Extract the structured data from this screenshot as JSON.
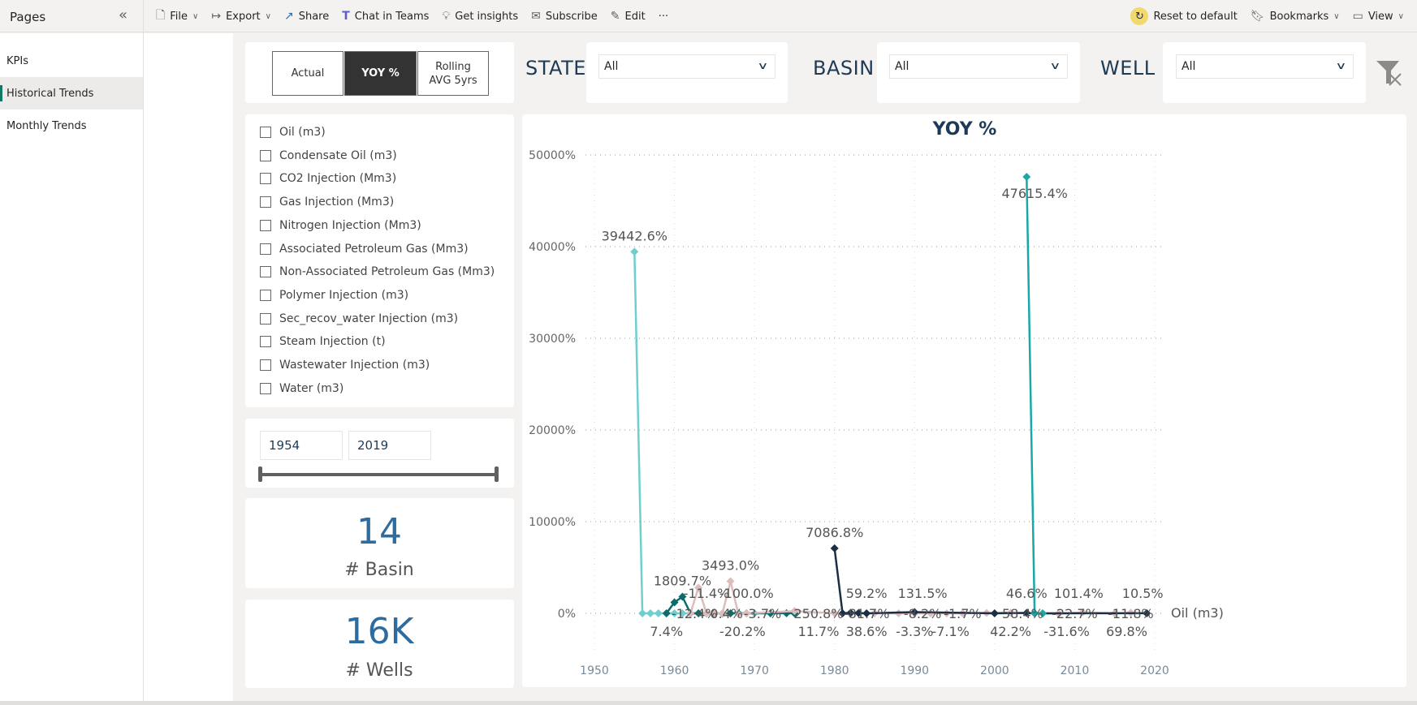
{
  "pages_panel": {
    "title": "Pages",
    "items": [
      {
        "label": "KPIs",
        "active": false
      },
      {
        "label": "Historical Trends",
        "active": true
      },
      {
        "label": "Monthly Trends",
        "active": false
      }
    ]
  },
  "toolbar": {
    "file": "File",
    "export": "Export",
    "share": "Share",
    "chat_in_teams": "Chat in Teams",
    "get_insights": "Get insights",
    "subscribe": "Subscribe",
    "edit": "Edit",
    "more": "···",
    "reset": "Reset to default",
    "bookmarks": "Bookmarks",
    "view": "View"
  },
  "mode_toggle": {
    "actual": "Actual",
    "yoy": "YOY %",
    "rolling_1": "Rolling",
    "rolling_2": "AVG 5yrs",
    "selected": "YOY %"
  },
  "filters": {
    "state": {
      "label": "STATE",
      "value": "All"
    },
    "basin": {
      "label": "BASIN",
      "value": "All"
    },
    "well": {
      "label": "WELL",
      "value": "All"
    }
  },
  "measures": [
    {
      "label": "Oil (m3)",
      "checked": false
    },
    {
      "label": "Condensate Oil (m3)",
      "checked": false
    },
    {
      "label": "CO2 Injection (Mm3)",
      "checked": false
    },
    {
      "label": "Gas Injection (Mm3)",
      "checked": false
    },
    {
      "label": "Nitrogen Injection (Mm3)",
      "checked": false
    },
    {
      "label": "Associated Petroleum Gas (Mm3)",
      "checked": false
    },
    {
      "label": "Non-Associated Petroleum Gas (Mm3)",
      "checked": false
    },
    {
      "label": "Polymer Injection (m3)",
      "checked": false
    },
    {
      "label": "Sec_recov_water Injection (m3)",
      "checked": false
    },
    {
      "label": "Steam Injection (t)",
      "checked": false
    },
    {
      "label": "Wastewater Injection (m3)",
      "checked": false
    },
    {
      "label": "Water (m3)",
      "checked": false
    }
  ],
  "year_range": {
    "start": "1954",
    "end": "2019",
    "slider_start_fraction": 0,
    "slider_end_fraction": 1
  },
  "kpis": {
    "basin": {
      "value": "14",
      "label": "# Basin"
    },
    "wells": {
      "value": "16K",
      "label": "# Wells"
    }
  },
  "colors": {
    "series_light_teal": "#6fcfcf",
    "series_teal": "#1aa7a7",
    "series_dark_teal": "#0e6b6b",
    "series_navy": "#1c2e45",
    "series_pink": "#dcbcbc",
    "title": "#1f3a56",
    "kpi": "#2e6b9e"
  },
  "chart_data": {
    "type": "line",
    "title": "YOY %",
    "xlabel": "",
    "ylabel": "",
    "x_ticks": [
      "1950",
      "1960",
      "1970",
      "1980",
      "1990",
      "2000",
      "2010",
      "2020"
    ],
    "y_ticks": [
      "0%",
      "10000%",
      "20000%",
      "30000%",
      "40000%",
      "50000%"
    ],
    "xlim": [
      1950,
      2020
    ],
    "ylim": [
      0,
      50000
    ],
    "grid": true,
    "end_label": "Oil (m3)",
    "series": [
      {
        "name": "light-teal",
        "color": "#6fcfcf",
        "points": [
          [
            1955,
            39442.6
          ],
          [
            1956,
            0
          ],
          [
            1957,
            0
          ],
          [
            1958,
            0
          ],
          [
            1959,
            0
          ],
          [
            1960,
            0
          ],
          [
            1961,
            0
          ],
          [
            1962,
            0
          ],
          [
            1963,
            0
          ],
          [
            1964,
            0
          ],
          [
            1965,
            0
          ],
          [
            1966,
            0
          ],
          [
            1967,
            0
          ],
          [
            1968,
            0
          ],
          [
            1969,
            0
          ],
          [
            1970,
            0
          ]
        ]
      },
      {
        "name": "dark-teal",
        "color": "#0e6b6b",
        "points": [
          [
            1959,
            0
          ],
          [
            1960,
            1200
          ],
          [
            1961,
            1809.7
          ],
          [
            1962,
            -12.4
          ],
          [
            1963,
            0
          ],
          [
            1964,
            0
          ],
          [
            1965,
            0
          ],
          [
            1966,
            -20.2
          ],
          [
            1967,
            0
          ],
          [
            1968,
            -3.7
          ],
          [
            1969,
            0
          ],
          [
            1972,
            0
          ],
          [
            1974,
            11.7
          ],
          [
            1975,
            0
          ]
        ]
      },
      {
        "name": "pink",
        "color": "#dcbcbc",
        "points": [
          [
            1962,
            0
          ],
          [
            1963,
            2800
          ],
          [
            1964,
            0
          ],
          [
            1965,
            -11.4
          ],
          [
            1966,
            0.4
          ],
          [
            1967,
            3493.0
          ],
          [
            1968,
            -100.0
          ],
          [
            1969,
            0
          ],
          [
            1975,
            250.8
          ],
          [
            1980,
            0
          ],
          [
            1982,
            -81.7
          ],
          [
            1985,
            0
          ],
          [
            1988,
            -3.3
          ],
          [
            1990,
            -8.2
          ],
          [
            1992,
            -7.1
          ],
          [
            1994,
            -1.7
          ],
          [
            1996,
            0
          ],
          [
            1999,
            42.2
          ],
          [
            2002,
            58.4
          ],
          [
            2006,
            -22.7
          ],
          [
            2008,
            -31.6
          ],
          [
            2011,
            101.4
          ],
          [
            2015,
            -11.8
          ],
          [
            2017,
            69.8
          ],
          [
            2019,
            0
          ]
        ]
      },
      {
        "name": "navy",
        "color": "#1c2e45",
        "points": [
          [
            1980,
            7086.8
          ],
          [
            1981,
            0
          ],
          [
            1982,
            59.2
          ],
          [
            1983,
            38.6
          ],
          [
            1984,
            0
          ],
          [
            1990,
            131.5
          ],
          [
            2000,
            0
          ],
          [
            2004,
            46.6
          ],
          [
            2005,
            0
          ],
          [
            2019,
            10.5
          ]
        ]
      },
      {
        "name": "teal",
        "color": "#1aa7a7",
        "points": [
          [
            2004,
            47615.4
          ],
          [
            2005,
            0
          ],
          [
            2006,
            0
          ]
        ]
      }
    ],
    "data_labels": [
      {
        "x": 1955,
        "y": 39442.6,
        "text": "39442.6%",
        "pos": "above"
      },
      {
        "x": 2005,
        "y": 47615.4,
        "text": "47615.4%",
        "pos": "below"
      },
      {
        "x": 1980,
        "y": 7086.8,
        "text": "7086.8%",
        "pos": "above"
      },
      {
        "x": 1961,
        "y": 1809.7,
        "text": "1809.7%",
        "pos": "above"
      },
      {
        "x": 1967,
        "y": 3493.0,
        "text": "3493.0%",
        "pos": "above"
      },
      {
        "x": 1964,
        "y": 600,
        "text": "-11.4%",
        "pos": "plain"
      },
      {
        "x": 1962.5,
        "y": 0,
        "text": "-12.4%",
        "pos": "onaxis"
      },
      {
        "x": 1966.5,
        "y": 0,
        "text": "0.4%",
        "pos": "onaxis"
      },
      {
        "x": 1971,
        "y": 0,
        "text": "-3.7%",
        "pos": "onaxis"
      },
      {
        "x": 1969,
        "y": 600,
        "text": "-100.0%",
        "pos": "plain"
      },
      {
        "x": 1959,
        "y": -600,
        "text": "7.4%",
        "pos": "plain"
      },
      {
        "x": 1968.5,
        "y": -600,
        "text": "-20.2%",
        "pos": "plain"
      },
      {
        "x": 1978,
        "y": 0,
        "text": "250.8%",
        "pos": "onaxis"
      },
      {
        "x": 1978,
        "y": -600,
        "text": "11.7%",
        "pos": "plain"
      },
      {
        "x": 1984,
        "y": 600,
        "text": "59.2%",
        "pos": "plain"
      },
      {
        "x": 1984,
        "y": 0,
        "text": "-81.7%",
        "pos": "onaxis"
      },
      {
        "x": 1984,
        "y": -600,
        "text": "38.6%",
        "pos": "plain"
      },
      {
        "x": 1990,
        "y": -600,
        "text": "-3.3%",
        "pos": "plain"
      },
      {
        "x": 1991,
        "y": 0,
        "text": "-8.2%",
        "pos": "onaxis"
      },
      {
        "x": 1991,
        "y": 600,
        "text": "131.5%",
        "pos": "plain"
      },
      {
        "x": 1994.5,
        "y": -600,
        "text": "-7.1%",
        "pos": "plain"
      },
      {
        "x": 1996,
        "y": 0,
        "text": "-1.7%",
        "pos": "onaxis"
      },
      {
        "x": 2002,
        "y": -600,
        "text": "42.2%",
        "pos": "plain"
      },
      {
        "x": 2003.5,
        "y": 0,
        "text": "58.4%",
        "pos": "onaxis"
      },
      {
        "x": 2004,
        "y": 600,
        "text": "46.6%",
        "pos": "plain"
      },
      {
        "x": 2010.5,
        "y": 600,
        "text": "101.4%",
        "pos": "plain"
      },
      {
        "x": 2010,
        "y": 0,
        "text": "-22.7%",
        "pos": "onaxis"
      },
      {
        "x": 2009,
        "y": -600,
        "text": "-31.6%",
        "pos": "plain"
      },
      {
        "x": 2017,
        "y": 0,
        "text": "-11.8%",
        "pos": "onaxis"
      },
      {
        "x": 2016.5,
        "y": -600,
        "text": "69.8%",
        "pos": "plain"
      },
      {
        "x": 2018.5,
        "y": 600,
        "text": "10.5%",
        "pos": "plain"
      }
    ]
  }
}
